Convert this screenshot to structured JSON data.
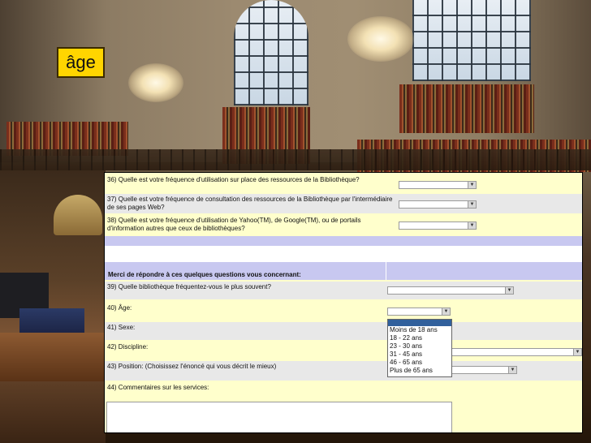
{
  "slide_title": "âge",
  "questions": [
    {
      "id": "q36",
      "text": "36) Quelle est votre fréquence d'utilisation sur place des ressources de la Bibliothèque?"
    },
    {
      "id": "q37",
      "text": "37) Quelle est votre fréquence de consultation des ressources de la Bibliothèque par l'intermédiaire de ses pages Web?"
    },
    {
      "id": "q38",
      "text": "38) Quelle est votre fréquence d'utilisation de Yahoo(TM), de Google(TM), ou de portails d'information autres que ceux de bibliothèques?"
    }
  ],
  "section_header": "Merci de répondre à ces quelques questions vous concernant:",
  "q39": "39) Quelle bibliothèque fréquentez-vous le plus souvent?",
  "q40": "40) Âge:",
  "q41": "41) Sexe:",
  "q42": "42) Discipline:",
  "q43": "43) Position: (Choisissez l'énoncé qui vous décrit le mieux)",
  "q44": "44) Commentaires sur les services:",
  "age_options": [
    "Moins de 18 ans",
    "18 - 22 ans",
    "23 - 30 ans",
    "31 - 45 ans",
    "46 - 65 ans",
    "Plus de 65 ans"
  ]
}
